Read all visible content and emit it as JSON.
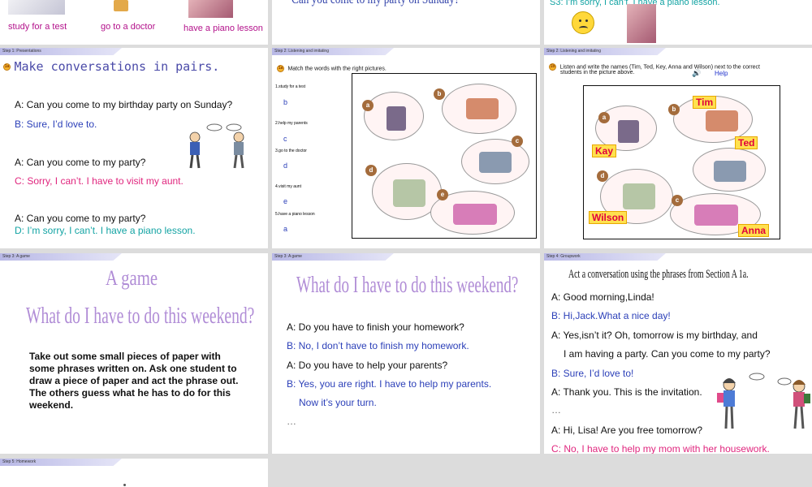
{
  "top": {
    "labels": [
      "study for a test",
      "go to a doctor",
      "have a piano lesson"
    ],
    "middle_text": "Can you come to my party on Sunday?",
    "s3_line": "S3: I’m sorry, I can’t. I have a piano lesson."
  },
  "slide1": {
    "step": "Step 1:  Presentations",
    "badge": "1a",
    "title": "Make conversations in pairs.",
    "lines": [
      "A: Can you come to my  birthday party on Sunday?",
      "B: Sure, I’d love to.",
      "A: Can you come to my party?",
      "C: Sorry, I can’t. I have to visit my aunt.",
      "A: Can you come to my party?",
      "D: I’m sorry, I can’t. I have a piano lesson."
    ]
  },
  "slide2": {
    "step": "Step 2:  Listening and imitating",
    "badge": "1a",
    "instruction": "Match the words with the right pictures.",
    "items": [
      {
        "phrase": "1.study for  a test",
        "answer": "b"
      },
      {
        "phrase": "2.help my parents",
        "answer": "c"
      },
      {
        "phrase": "3.go to the doctor",
        "answer": "d"
      },
      {
        "phrase": "4.visit my aunt",
        "answer": "e"
      },
      {
        "phrase": "5.have a piano lesson",
        "answer": "a"
      }
    ],
    "picture_letters": [
      "a",
      "b",
      "c",
      "d",
      "e"
    ]
  },
  "slide3": {
    "step": "Step 2:  Listening and imitating",
    "badge": "1b",
    "instruction_line1": "Listen and write the names (Tim, Ted, Key, Anna and Wilson) next to the correct",
    "instruction_line2": "students in the picture above.",
    "help": "Help",
    "names": [
      "Tim",
      "Kay",
      "Ted",
      "Wilson",
      "Anna"
    ],
    "picture_letters": [
      "a",
      "b",
      "c",
      "d",
      "e"
    ]
  },
  "slide4": {
    "step": "Step 3:  A game",
    "title": "A game",
    "subtitle": "What do I have to do this weekend?",
    "body": [
      "Take out some small pieces of paper  with",
      "some phrases written on. Ask one student to",
      "draw a piece of paper and act the phrase out.",
      "The others guess what he has to do for this",
      "weekend."
    ]
  },
  "slide5": {
    "step": "Step 3:  A game",
    "title": "What do I have to do this weekend?",
    "lines": [
      "A: Do you have to finish your homework?",
      "B: No, I don’t have to finish my homework.",
      "A: Do you have to help your parents?",
      "B: Yes, you are right. I have to help my parents.",
      "Now it’s your turn.",
      "…"
    ]
  },
  "slide6": {
    "step": "Step 4:  Groupwork",
    "title": "Act a conversation using the phrases from Section A 1a.",
    "lines": [
      "A: Good morning,Linda!",
      "B: Hi,Jack.What a nice day!",
      "A: Yes,isn’t it? Oh, tomorrow is my birthday, and",
      "I am having a party. Can you come to my party?",
      "B: Sure, I’d love to!",
      "A: Thank you. This is the invitation.",
      "…",
      "A: Hi, Lisa! Are you free tomorrow?",
      "C: No, I have to help my mom with her housework."
    ]
  },
  "slide7": {
    "step": "Step 5:  Homework"
  },
  "colors": {
    "blue_text": "#2b3fb8",
    "pink_text": "#e0267e",
    "teal_text": "#12a3a3",
    "name_label_bg": "#ffe14f",
    "name_label_text": "#e0003c"
  }
}
